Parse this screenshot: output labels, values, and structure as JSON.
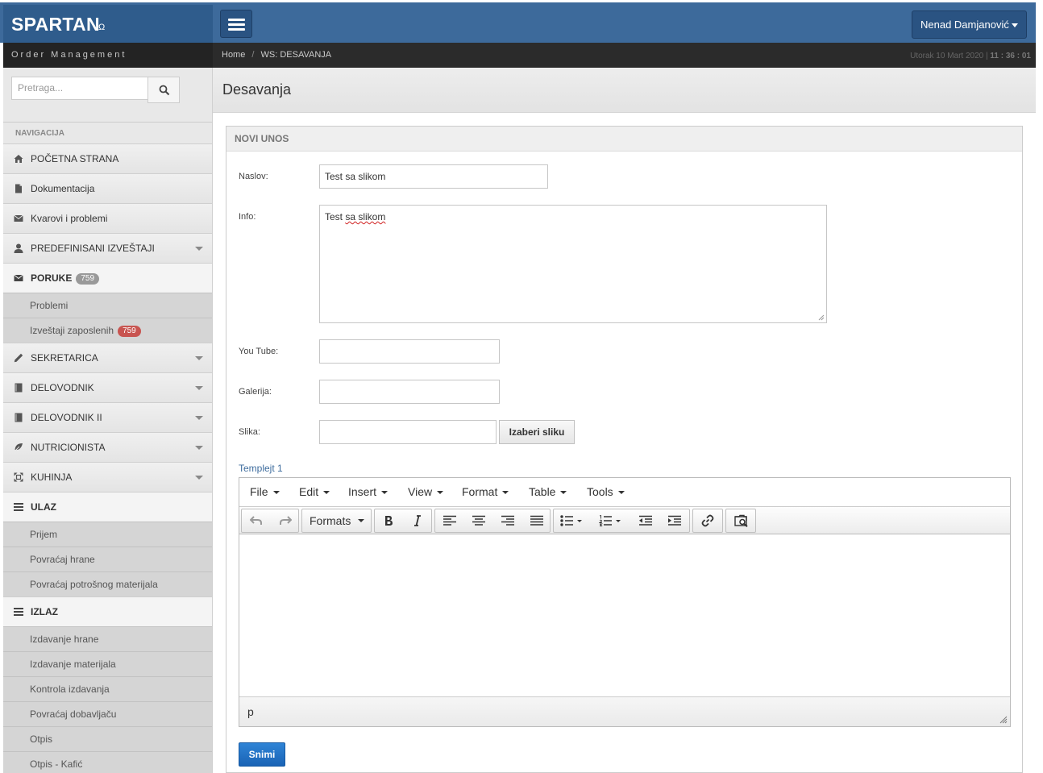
{
  "brand": {
    "name": "SPARTAN",
    "symbol": "Ω",
    "subtitle": "Order Management"
  },
  "header": {
    "user_name": "Nenad Damjanović"
  },
  "breadcrumb": {
    "home": "Home",
    "separator": "/",
    "current": "WS: DESAVANJA"
  },
  "clock": {
    "date": "Utorak 10 Mart 2020 |",
    "time": "11 : 36 : 01"
  },
  "search": {
    "placeholder": "Pretraga..."
  },
  "nav": {
    "heading": "NAVIGACIJA",
    "items": [
      {
        "label": "POČETNA STRANA",
        "icon": "home-icon"
      },
      {
        "label": "Dokumentacija",
        "icon": "file-icon"
      },
      {
        "label": "Kvarovi i problemi",
        "icon": "envelope-icon"
      },
      {
        "label": "PREDEFINISANI IZVEŠTAJI",
        "icon": "user-icon"
      },
      {
        "label": "PORUKE",
        "icon": "envelope-icon",
        "badge": "759"
      },
      {
        "label": "SEKRETARICA",
        "icon": "pencil-icon"
      },
      {
        "label": "DELOVODNIK",
        "icon": "book-icon"
      },
      {
        "label": "DELOVODNIK II",
        "icon": "book-icon"
      },
      {
        "label": "NUTRICIONISTA",
        "icon": "leaf-icon"
      },
      {
        "label": "KUHINJA",
        "icon": "fullscreen-icon"
      },
      {
        "label": "ULAZ",
        "icon": "list-icon"
      },
      {
        "label": "IZLAZ",
        "icon": "list-icon"
      }
    ],
    "poruke_sub": [
      {
        "label": "Problemi"
      },
      {
        "label": "Izveštaji zaposlenih",
        "badge": "759"
      }
    ],
    "ulaz_sub": [
      {
        "label": "Prijem"
      },
      {
        "label": "Povraćaj hrane"
      },
      {
        "label": "Povraćaj potrošnog materijala"
      }
    ],
    "izlaz_sub": [
      {
        "label": "Izdavanje hrane"
      },
      {
        "label": "Izdavanje materijala"
      },
      {
        "label": "Kontrola izdavanja"
      },
      {
        "label": "Povraćaj dobavljaču"
      },
      {
        "label": "Otpis"
      },
      {
        "label": "Otpis - Kafić"
      }
    ]
  },
  "page": {
    "title": "Desavanja"
  },
  "form": {
    "panel_title": "NOVI UNOS",
    "naslov_label": "Naslov:",
    "naslov_value": "Test sa slikom",
    "info_label": "Info:",
    "info_value_plain": "Test ",
    "info_value_marked": "sa slikom",
    "youtube_label": "You Tube:",
    "youtube_value": "",
    "galerija_label": "Galerija:",
    "galerija_value": "",
    "slika_label": "Slika:",
    "slika_value": "",
    "choose_button": "Izaberi sliku",
    "template_label": "Templejt 1",
    "save_button": "Snimi"
  },
  "editor": {
    "menus": [
      "File",
      "Edit",
      "Insert",
      "View",
      "Format",
      "Table",
      "Tools"
    ],
    "formats_label": "Formats",
    "status_path": "p"
  },
  "colors": {
    "topbar": "#3d6a9b",
    "brand": "#2f5c8c",
    "accent": "#1a63b5",
    "badge_red": "#c85450"
  }
}
